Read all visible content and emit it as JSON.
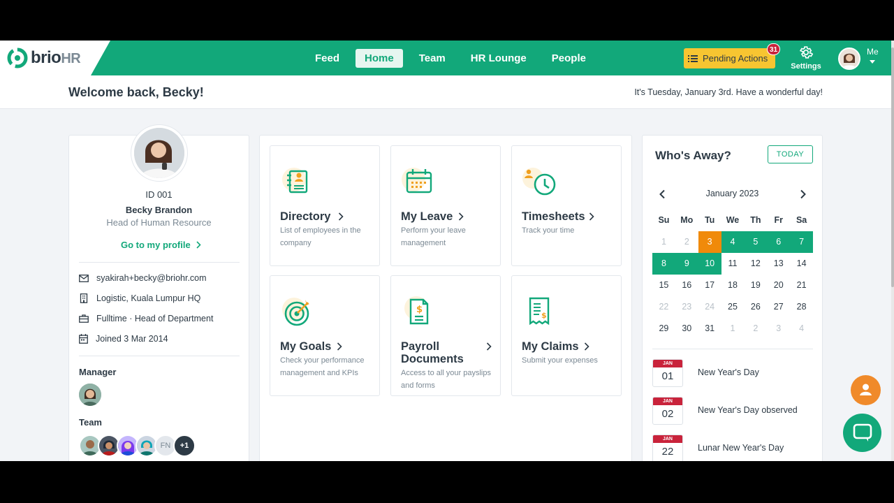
{
  "brand": {
    "name": "brio",
    "suffix": "HR"
  },
  "nav": {
    "links": [
      {
        "label": "Feed",
        "active": false
      },
      {
        "label": "Home",
        "active": true
      },
      {
        "label": "Team",
        "active": false
      },
      {
        "label": "HR Lounge",
        "active": false
      },
      {
        "label": "People",
        "active": false
      }
    ],
    "pending_label": "Pending Actions",
    "pending_count": "31",
    "settings_label": "Settings",
    "me_label": "Me"
  },
  "welcome": {
    "title": "Welcome back, Becky!",
    "date_text": "It's Tuesday, January 3rd. Have a wonderful day!"
  },
  "profile": {
    "id": "ID 001",
    "name": "Becky Brandon",
    "role": "Head of Human Resource",
    "link_label": "Go to my profile",
    "email": "syakirah+becky@briohr.com",
    "location": "Logistic, Kuala Lumpur HQ",
    "employment": "Fulltime · Head of Department",
    "joined": "Joined 3 Mar 2014",
    "manager_label": "Manager",
    "team_label": "Team",
    "team_initials": "FN",
    "team_more": "+1"
  },
  "apps": [
    {
      "title": "Directory",
      "desc": "List of employees in the company",
      "icon": "directory-icon"
    },
    {
      "title": "My Leave",
      "desc": "Perform your leave management",
      "icon": "calendar-icon"
    },
    {
      "title": "Timesheets",
      "desc": "Track your time",
      "icon": "clock-icon"
    },
    {
      "title": "My Goals",
      "desc": "Check your performance management and KPIs",
      "icon": "target-icon"
    },
    {
      "title": "Payroll Documents",
      "desc": "Access to all your payslips and forms",
      "icon": "payroll-document-icon"
    },
    {
      "title": "My Claims",
      "desc": "Submit your expenses",
      "icon": "receipt-icon"
    }
  ],
  "away": {
    "title": "Who's Away?",
    "today_label": "TODAY",
    "month": "January 2023",
    "weekdays": [
      "Su",
      "Mo",
      "Tu",
      "We",
      "Th",
      "Fr",
      "Sa"
    ],
    "weeks": [
      [
        {
          "d": "1",
          "s": "muted"
        },
        {
          "d": "2",
          "s": "muted"
        },
        {
          "d": "3",
          "s": "today"
        },
        {
          "d": "4",
          "s": "away"
        },
        {
          "d": "5",
          "s": "away"
        },
        {
          "d": "6",
          "s": "away"
        },
        {
          "d": "7",
          "s": "away"
        }
      ],
      [
        {
          "d": "8",
          "s": "away"
        },
        {
          "d": "9",
          "s": "away"
        },
        {
          "d": "10",
          "s": "away"
        },
        {
          "d": "11",
          "s": ""
        },
        {
          "d": "12",
          "s": ""
        },
        {
          "d": "13",
          "s": ""
        },
        {
          "d": "14",
          "s": ""
        }
      ],
      [
        {
          "d": "15",
          "s": ""
        },
        {
          "d": "16",
          "s": ""
        },
        {
          "d": "17",
          "s": ""
        },
        {
          "d": "18",
          "s": ""
        },
        {
          "d": "19",
          "s": ""
        },
        {
          "d": "20",
          "s": ""
        },
        {
          "d": "21",
          "s": ""
        }
      ],
      [
        {
          "d": "22",
          "s": "muted"
        },
        {
          "d": "23",
          "s": "muted"
        },
        {
          "d": "24",
          "s": "muted"
        },
        {
          "d": "25",
          "s": ""
        },
        {
          "d": "26",
          "s": ""
        },
        {
          "d": "27",
          "s": ""
        },
        {
          "d": "28",
          "s": ""
        }
      ],
      [
        {
          "d": "29",
          "s": ""
        },
        {
          "d": "30",
          "s": ""
        },
        {
          "d": "31",
          "s": ""
        },
        {
          "d": "1",
          "s": "muted"
        },
        {
          "d": "2",
          "s": "muted"
        },
        {
          "d": "3",
          "s": "muted"
        },
        {
          "d": "4",
          "s": "muted"
        }
      ]
    ],
    "holidays": [
      {
        "month": "JAN",
        "day": "01",
        "name": "New Year's Day"
      },
      {
        "month": "JAN",
        "day": "02",
        "name": "New Year's Day observed"
      },
      {
        "month": "JAN",
        "day": "22",
        "name": "Lunar New Year's Day"
      }
    ]
  },
  "colors": {
    "brand_green": "#12a87a",
    "pending_yellow": "#f7c531",
    "today_orange": "#f08a0a",
    "badge_red": "#c9233b"
  }
}
